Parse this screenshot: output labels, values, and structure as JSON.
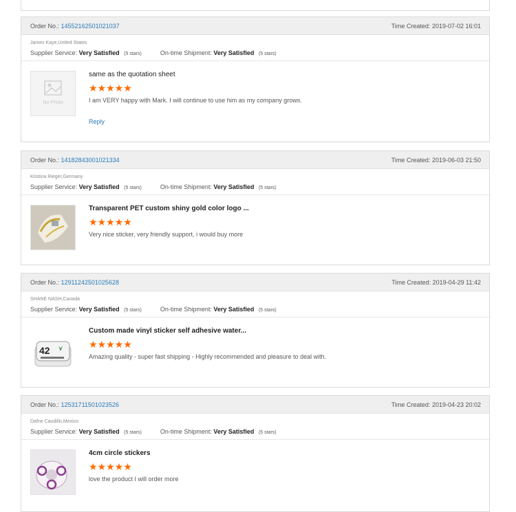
{
  "labels": {
    "order_no": "Order No.:",
    "time_created": "Time Created:",
    "supplier_service": "Supplier Service:",
    "ontime_shipment": "On-time Shipment:",
    "reply": "Reply",
    "no_photo": "No Photo"
  },
  "reviews": [
    {
      "order_no": "14552162501021037",
      "time": "2019-07-02 16:01",
      "buyer": "James Kaye,United States",
      "service_rating": "Very Satisfied",
      "service_stars": "(5 stars)",
      "shipment_rating": "Very Satisfied",
      "shipment_stars": "(5 stars)",
      "product": "same as the quotation sheet",
      "stars": 5,
      "comment": "I am VERY happy with Mark. I will continue to use him as my company grows."
    },
    {
      "order_no": "14182843001021334",
      "time": "2019-06-03 21:50",
      "buyer": "Kristina Rieger,Germany",
      "service_rating": "Very Satisfied",
      "service_stars": "(5 stars)",
      "shipment_rating": "Very Satisfied",
      "shipment_stars": "(5 stars)",
      "product": "Transparent PET custom shiny gold color logo ...",
      "stars": 5,
      "comment": "Very nice sticker, very friendly support, i would buy more"
    },
    {
      "order_no": "12911242501025628",
      "time": "2019-04-29 11:42",
      "buyer": "SHANE NASH,Canada",
      "service_rating": "Very Satisfied",
      "service_stars": "(5 stars)",
      "shipment_rating": "Very Satisfied",
      "shipment_stars": "(5 stars)",
      "product": "Custom made vinyl sticker self adhesive water...",
      "stars": 5,
      "comment": "Amazing quality - super fast shipping - Highly recommended and pleasure to deal with."
    },
    {
      "order_no": "12531711501023526",
      "time": "2019-04-23 20:02",
      "buyer": "Dafne Caudillo,Mexico",
      "service_rating": "Very Satisfied",
      "service_stars": "(5 stars)",
      "shipment_rating": "Very Satisfied",
      "shipment_stars": "(5 stars)",
      "product": "4cm circle stickers",
      "stars": 5,
      "comment": "love the product I will order more"
    }
  ],
  "star_glyphs": "★★★★★",
  "colors": {
    "link": "#2a7ab8",
    "star": "#ff6a00",
    "header_bg": "#efefef"
  }
}
